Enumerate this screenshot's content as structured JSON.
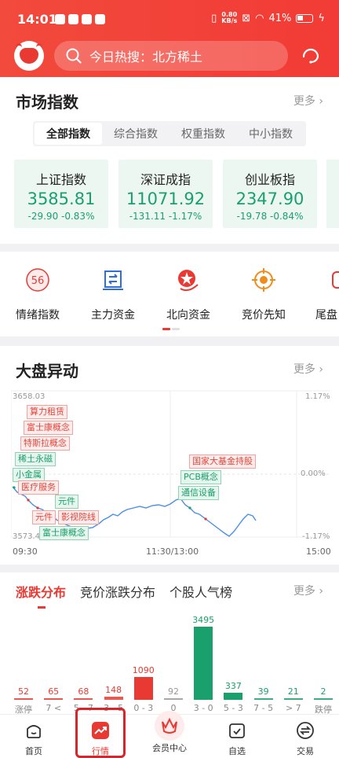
{
  "status_bar": {
    "time": "14:01",
    "net_speed_value": "0.80",
    "net_speed_unit": "KB/s",
    "battery": "41%"
  },
  "search": {
    "placeholder": "今日热搜：北方稀土"
  },
  "market": {
    "title": "市场指数",
    "more": "更多 ›",
    "tabs": [
      "全部指数",
      "综合指数",
      "权重指数",
      "中小指数"
    ],
    "indices": [
      {
        "name": "上证指数",
        "value": "3585.81",
        "change": "-29.90  -0.83%"
      },
      {
        "name": "深证成指",
        "value": "11071.92",
        "change": "-131.11  -1.17%"
      },
      {
        "name": "创业板指",
        "value": "2347.90",
        "change": "-19.78  -0.84%"
      }
    ]
  },
  "tools": [
    {
      "label": "情绪指数",
      "badge": "56",
      "icon": "gauge-icon"
    },
    {
      "label": "主力资金",
      "icon": "capital-flow-icon"
    },
    {
      "label": "北向资金",
      "icon": "hk-flower-icon"
    },
    {
      "label": "竞价先知",
      "icon": "target-icon"
    },
    {
      "label": "尾盘",
      "icon": "tail-icon"
    }
  ],
  "abnormal": {
    "title": "大盘异动",
    "more": "更多 ›",
    "y_left_top": "3658.03",
    "y_left_bottom": "3573.41",
    "y_right_top": "1.17%",
    "y_right_mid": "0.00%",
    "y_right_bottom": "-1.17%",
    "time_start": "09:30",
    "time_mid": "11:30/13:00",
    "time_end": "15:00",
    "tags": [
      {
        "text": "算力租赁",
        "color": "r"
      },
      {
        "text": "富士康概念",
        "color": "r"
      },
      {
        "text": "特斯拉概念",
        "color": "r"
      },
      {
        "text": "稀土永磁",
        "color": "g"
      },
      {
        "text": "小金属",
        "color": "g"
      },
      {
        "text": "医疗服务",
        "color": "r"
      },
      {
        "text": "元件",
        "color": "g"
      },
      {
        "text": "元件",
        "color": "r"
      },
      {
        "text": "影视院线",
        "color": "r"
      },
      {
        "text": "富士康概念",
        "color": "g"
      },
      {
        "text": "国家大基金持股",
        "color": "r"
      },
      {
        "text": "PCB概念",
        "color": "g"
      },
      {
        "text": "通信设备",
        "color": "g"
      }
    ]
  },
  "distribution": {
    "tabs": [
      "涨跌分布",
      "竞价涨跌分布",
      "个股人气榜"
    ],
    "more": "更多 ›",
    "bars": [
      {
        "value": 52,
        "label": "涨停"
      },
      {
        "value": 65,
        "label": "7 <"
      },
      {
        "value": 68,
        "label": "5 - 7"
      },
      {
        "value": 148,
        "label": "3 - 5"
      },
      {
        "value": 1090,
        "label": "0 - 3"
      },
      {
        "value": 92,
        "label": "0"
      },
      {
        "value": 3495,
        "label": "3 - 0"
      },
      {
        "value": 337,
        "label": "5 - 3"
      },
      {
        "value": 39,
        "label": "7 - 5"
      },
      {
        "value": 21,
        "label": "> 7"
      },
      {
        "value": 2,
        "label": "跌停"
      }
    ]
  },
  "nav": [
    "首页",
    "行情",
    "会员中心",
    "自选",
    "交易"
  ],
  "colors": {
    "up": "#e83a32",
    "down": "#1aa06d",
    "brand": "#f23b36"
  }
}
